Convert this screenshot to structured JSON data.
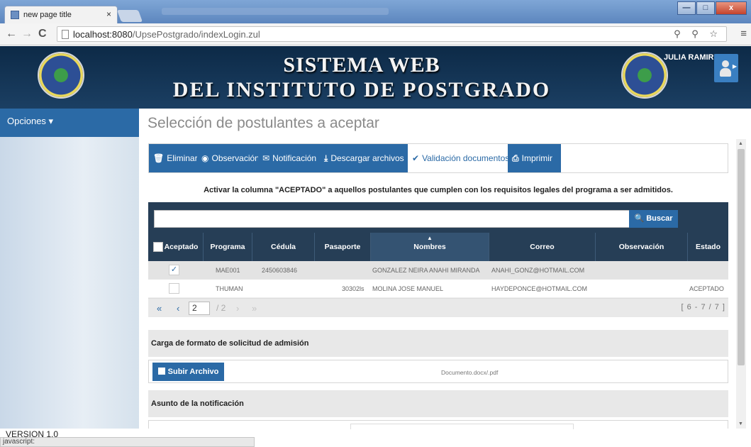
{
  "browser": {
    "tab_title": "new page title",
    "tab_close": "×",
    "url_host": "localhost:8080",
    "url_path": "/UpsePostgrado/indexLogin.zul",
    "addr_icons": "⚲ ⚲ ☆",
    "menu": "≡",
    "back": "←",
    "forward": "→",
    "reload": "C"
  },
  "window_buttons": {
    "minimize": "—",
    "maximize": "□",
    "close": "x"
  },
  "header": {
    "title_line1": "SISTEMA WEB",
    "title_line2": "DEL INSTITUTO DE POSTGRADO",
    "user_name": "JULIA RAMIREZ"
  },
  "sidebar": {
    "menu_label": "Opciones ▾",
    "version": "VERSION 1.0"
  },
  "status_bar": "javascript:",
  "main": {
    "title": "Selección de postulantes a aceptar",
    "toolbar": [
      {
        "icon": "trash-icon",
        "glyph": "🗑",
        "label": "Eliminar"
      },
      {
        "icon": "eye-icon",
        "glyph": "◉",
        "label": "Observación"
      },
      {
        "icon": "envelope-icon",
        "glyph": "✉",
        "label": "Notificación"
      },
      {
        "icon": "download-icon",
        "glyph": "⤓",
        "label": "Descargar archivos"
      },
      {
        "icon": "check-icon",
        "glyph": "✔",
        "label": "Validación documentos",
        "active": true
      },
      {
        "icon": "print-icon",
        "glyph": "⎙",
        "label": "Imprimir"
      }
    ],
    "instruction": "Activar la columna \"ACEPTADO\" a aquellos postulantes que cumplen con los requisitos legales del programa a ser admitidos.",
    "search": {
      "value": "",
      "button_label": "Buscar",
      "button_icon": "search-icon",
      "button_glyph": "🔍"
    },
    "table": {
      "columns": [
        "Aceptado",
        "Programa",
        "Cédula",
        "Pasaporte",
        "Nombres",
        "Correo",
        "Observación",
        "Estado"
      ],
      "sorted_column": "Nombres",
      "rows": [
        {
          "aceptado": true,
          "programa": "MAE001",
          "cedula": "2450603846",
          "pasaporte": "",
          "nombres": "GONZALEZ NEIRA ANAHI MIRANDA",
          "correo": "ANAHI_GONZ@HOTMAIL.COM",
          "observacion": "",
          "estado": ""
        },
        {
          "aceptado": false,
          "programa": "THUMAN",
          "cedula": "",
          "pasaporte": "30302ls",
          "nombres": "MOLINA JOSE MANUEL",
          "correo": "HAYDEPONCE@HOTMAIL.COM",
          "observacion": "",
          "estado": "ACEPTADO"
        }
      ]
    },
    "pager": {
      "first": "«",
      "prev": "‹",
      "next": "›",
      "last": "»",
      "current_page": "2",
      "total": "/ 2",
      "range": "[ 6 - 7 / 7 ]"
    },
    "upload_section": {
      "title": "Carga de formato de solicitud de admisión",
      "button_label": "Subir Archivo",
      "hint": "Documento.docx/.pdf"
    },
    "notification_section": {
      "title": "Asunto de la notificación"
    }
  }
}
